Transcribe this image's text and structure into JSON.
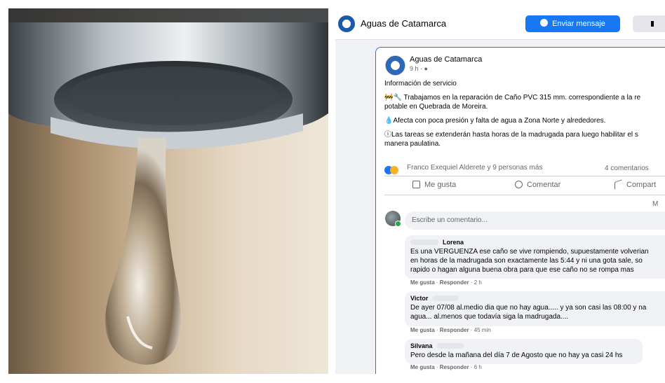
{
  "page": {
    "name": "Aguas de Catamarca",
    "send_message": "Enviar mensaje"
  },
  "post": {
    "author": "Aguas de Catamarca",
    "time": "9 h · ",
    "title": "Información de servicio",
    "line1a": "🚧🔧 Trabajamos en la reparación de  Caño PVC 315 mm. correspondiente a la re",
    "line1b": "potable en Quebrada de Moreira.",
    "line2": "💧Afecta con poca presión y falta de agua a Zona Norte y alrededores.",
    "line3a": "ⓘLas tareas se extenderán hasta horas de la madrugada para luego habilitar el s",
    "line3b": "manera paulatina.",
    "reactions": "Franco Exequiel Alderete y 9 personas más",
    "comments_count": "4 comentarios",
    "actions": {
      "like": "Me gusta",
      "comment": "Comentar",
      "share": "Compart"
    },
    "more_label": "M",
    "comment_placeholder": "Escribe un comentario..."
  },
  "comments": [
    {
      "author": "Lorena",
      "lines": [
        "Es una VERGUENZA ese caño se vive rompiendo, supuestamente volverian",
        "en horas de la madrugada son exactamente las 5:44 y ni una gota sale, so",
        "rapido o hagan alguna buena obra para que ese caño no se rompa mas"
      ],
      "like": "Me gusta",
      "reply": "Responder",
      "time": "2 h"
    },
    {
      "author": "Victor",
      "lines": [
        "De ayer 07/08 al.medio dia que no hay agua..... y ya son casi las 08:00 y na",
        "agua... al.menos que todavía siga la madrugada...."
      ],
      "like": "Me gusta",
      "reply": "Responder",
      "time": "45 min"
    },
    {
      "author": "Silvana",
      "lines": [
        "Pero desde la mañana del día 7 de Agosto que no hay ya casi 24 hs"
      ],
      "like": "Me gusta",
      "reply": "Responder",
      "time": "6 h"
    }
  ],
  "colors": {
    "accent": "#1877f2",
    "background": "#f0f2f5"
  }
}
